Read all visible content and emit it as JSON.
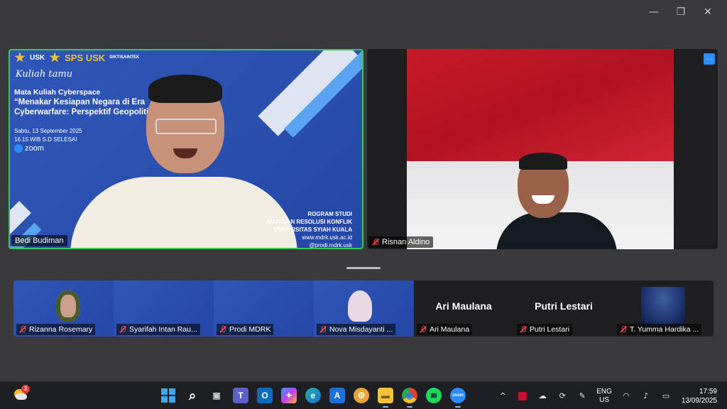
{
  "window": {
    "minimize_icon": "minimize-icon",
    "restore_icon": "restore-icon",
    "close_icon": "close-icon",
    "minimize_glyph": "—",
    "restore_glyph": "❐",
    "close_glyph": "✕"
  },
  "speaker_tile": {
    "name": "Bedi Budiman",
    "highlight_color": "#35c759",
    "slide": {
      "logo1": "USK",
      "logo2": "SPS USK",
      "logo3": "DIKTISAINTEK",
      "kicker": "Kuliah tamu",
      "title_line1": "Mata Kuliah Cyberspace",
      "title_line2": "“Menakar Kesiapan Negara di Era",
      "title_line3": "Cyberwarfare: Perspektif Geopolitik",
      "date_line1": "Sabtu, 13 September 2025",
      "date_line2": "16.15 WIB S.D SELESAI",
      "zoom_label": "zoom",
      "prodi_line1": "ROGRAM STUDI",
      "prodi_line2": "AMAI DAN RESOLUSI KONFLIK",
      "prodi_line3": "UNIVERSITAS SYIAH KUALA",
      "web_line1": "www.mdrk.usk.ac.id",
      "web_line2": "@prodi.mdrk.usk"
    }
  },
  "other_tile": {
    "name": "Risnan Aldino",
    "more_label": "···"
  },
  "gallery": [
    {
      "name": "Rizanna Rosemary",
      "type": "slide-face"
    },
    {
      "name": "Syarifah Intan Rau...",
      "type": "slide"
    },
    {
      "name": "Prodi MDRK",
      "type": "slide"
    },
    {
      "name": "Nova Misdayanti ...",
      "type": "slide-face"
    },
    {
      "name": "Ari Maulana",
      "big": "Ari Maulana",
      "type": "name"
    },
    {
      "name": "Putri Lestari",
      "big": "Putri Lestari",
      "type": "name"
    },
    {
      "name": "T. Yumma Hardika ...",
      "type": "photo"
    }
  ],
  "taskbar": {
    "weather_badge": "3",
    "apps": [
      {
        "icon": "windows-start-icon",
        "glyph": ""
      },
      {
        "icon": "search-icon",
        "glyph": "⌕"
      },
      {
        "icon": "task-view-icon",
        "glyph": "▣"
      },
      {
        "icon": "teams-icon",
        "glyph": "T"
      },
      {
        "icon": "outlook-icon",
        "glyph": "O"
      },
      {
        "icon": "copilot-icon",
        "glyph": "✦"
      },
      {
        "icon": "edge-icon",
        "glyph": "e"
      },
      {
        "icon": "azure-icon",
        "glyph": "A"
      },
      {
        "icon": "settings-app-icon",
        "glyph": "⚙"
      },
      {
        "icon": "file-explorer-icon",
        "glyph": "▬"
      },
      {
        "icon": "chrome-icon",
        "glyph": "◉"
      },
      {
        "icon": "spotify-icon",
        "glyph": "≋"
      },
      {
        "icon": "zoom-icon",
        "glyph": "zoom"
      }
    ],
    "tray": {
      "chevron": "^",
      "lang_line1": "ENG",
      "lang_line2": "US",
      "time": "17:59",
      "date": "13/09/2025"
    }
  }
}
